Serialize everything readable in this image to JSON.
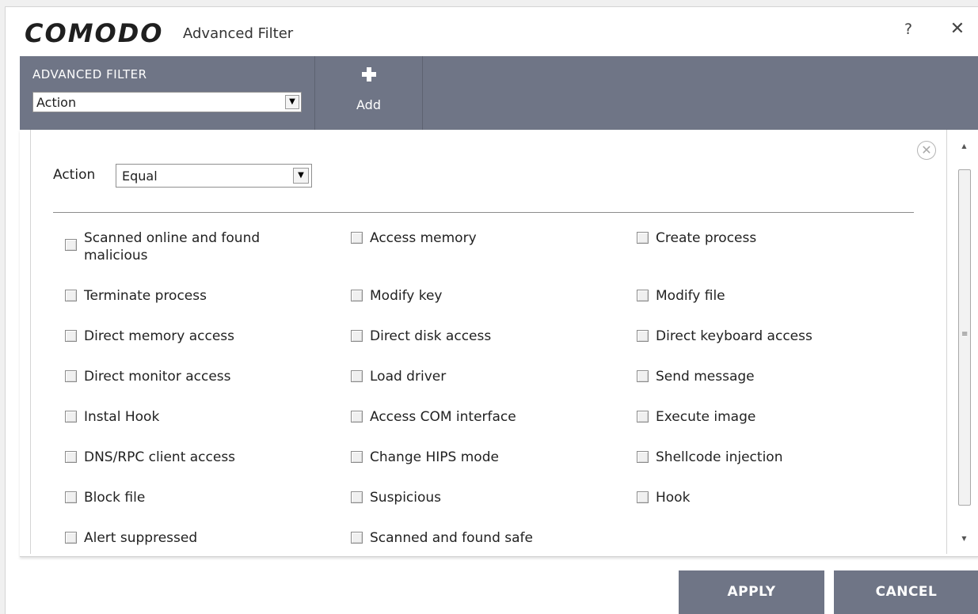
{
  "window": {
    "logo": "COMODO",
    "title": "Advanced Filter",
    "help_label": "?",
    "close_label": "✕"
  },
  "filter_bar": {
    "section_label": "ADVANCED FILTER",
    "filter_select_value": "Action",
    "add_label": "Add",
    "add_icon": "plus-icon"
  },
  "condition": {
    "field_label": "Action",
    "operator_value": "Equal",
    "remove_icon": "remove-circle-icon"
  },
  "options": [
    {
      "label": "Scanned online and found malicious",
      "checked": false
    },
    {
      "label": "Access memory",
      "checked": false
    },
    {
      "label": "Create process",
      "checked": false
    },
    {
      "label": "Terminate process",
      "checked": false
    },
    {
      "label": "Modify key",
      "checked": false
    },
    {
      "label": "Modify file",
      "checked": false
    },
    {
      "label": "Direct memory access",
      "checked": false
    },
    {
      "label": "Direct disk access",
      "checked": false
    },
    {
      "label": "Direct keyboard access",
      "checked": false
    },
    {
      "label": "Direct monitor access",
      "checked": false
    },
    {
      "label": "Load driver",
      "checked": false
    },
    {
      "label": "Send message",
      "checked": false
    },
    {
      "label": "Instal Hook",
      "checked": false
    },
    {
      "label": "Access COM interface",
      "checked": false
    },
    {
      "label": "Execute image",
      "checked": false
    },
    {
      "label": "DNS/RPC client access",
      "checked": false
    },
    {
      "label": "Change HIPS mode",
      "checked": false
    },
    {
      "label": "Shellcode injection",
      "checked": false
    },
    {
      "label": "Block file",
      "checked": false
    },
    {
      "label": "Suspicious",
      "checked": false
    },
    {
      "label": "Hook",
      "checked": false
    },
    {
      "label": "Alert suppressed",
      "checked": false
    },
    {
      "label": "Scanned and found safe",
      "checked": false
    }
  ],
  "buttons": {
    "apply_label": "APPLY",
    "cancel_label": "CANCEL"
  },
  "colors": {
    "header_band": "#6f7586",
    "button_bg": "#6f7586",
    "background": "#ffffff"
  }
}
